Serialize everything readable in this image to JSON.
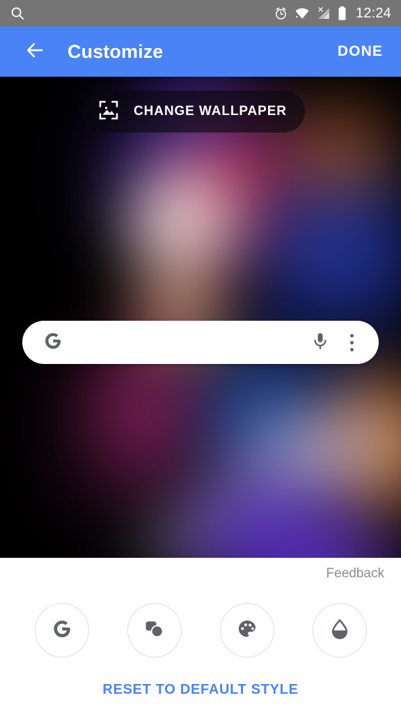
{
  "status_bar": {
    "search_icon": "search-icon",
    "alarm_icon": "alarm-clock-icon",
    "wifi_icon": "wifi-icon",
    "cellular_icon": "cellular-no-sim-icon",
    "battery_icon": "battery-full-icon",
    "time": "12:24",
    "background": "#757575"
  },
  "toolbar": {
    "back_icon": "back-arrow-icon",
    "title": "Customize",
    "done_label": "DONE",
    "background": "#4a83f6",
    "text_color": "#ffffff"
  },
  "preview": {
    "change_wallpaper": {
      "icon": "image-frame-icon",
      "label": "CHANGE WALLPAPER"
    },
    "search_widget": {
      "google_logo": "google-g-icon",
      "query_value": "",
      "placeholder": "",
      "mic_icon": "microphone-icon",
      "more_icon": "overflow-menu-icon"
    }
  },
  "bottom_panel": {
    "feedback_label": "Feedback",
    "style_options": [
      {
        "name": "google-logo-style",
        "icon": "google-g-icon",
        "label": ""
      },
      {
        "name": "icon-shape-style",
        "icon": "icon-shape-icon",
        "label": ""
      },
      {
        "name": "color-palette-style",
        "icon": "palette-icon",
        "label": ""
      },
      {
        "name": "tint-style",
        "icon": "water-drop-icon",
        "label": ""
      }
    ],
    "reset_label": "RESET TO DEFAULT STYLE",
    "reset_color": "#4a83f6",
    "background": "#ffffff"
  }
}
